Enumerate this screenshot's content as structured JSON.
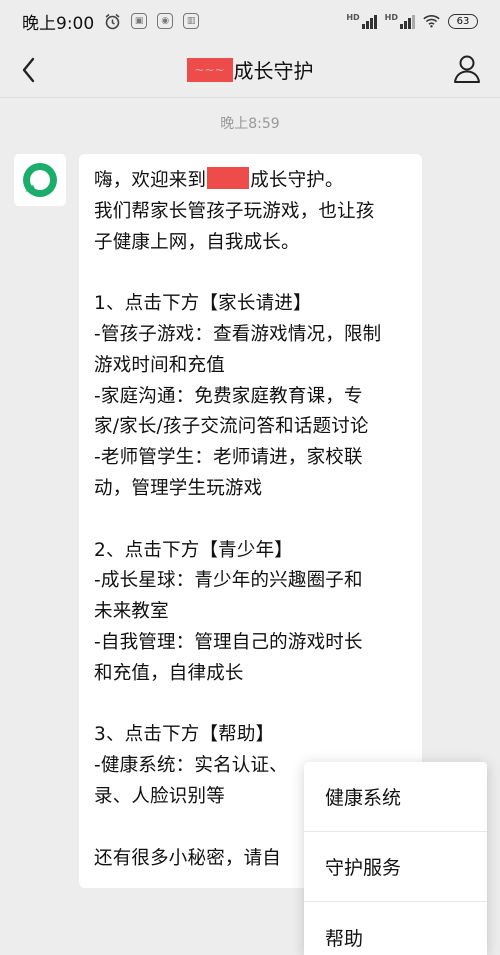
{
  "status_bar": {
    "time": "晚上9:00",
    "network_label_1": "HD",
    "network_label_2": "HD",
    "battery": "63"
  },
  "header": {
    "title_redacted": "~~~",
    "title_suffix": "成长守护",
    "back_icon": "chevron-left-icon",
    "profile_icon": "user-icon"
  },
  "chat": {
    "timestamp": "晚上8:59",
    "message": {
      "line1_before": "嗨，欢迎来到",
      "line1_after": "成长守护。",
      "lines": [
        "我们帮家长管孩子玩游戏，也让孩",
        "子健康上网，自我成长。",
        "",
        "1、点击下方【家长请进】",
        "-管孩子游戏：查看游戏情况，限制",
        "游戏时间和充值",
        "-家庭沟通：免费家庭教育课，专",
        "家/家长/孩子交流问答和话题讨论",
        "-老师管学生：老师请进，家校联",
        "动，管理学生玩游戏",
        "",
        "2、点击下方【青少年】",
        "-成长星球：青少年的兴趣圈子和",
        "未来教室",
        "-自我管理：管理自己的游戏时长",
        "和充值，自律成长",
        "",
        "3、点击下方【帮助】",
        "-健康系统：实名认证、",
        "录、人脸识别等",
        "",
        "还有很多小秘密，请自"
      ]
    }
  },
  "popup_menu": {
    "items": [
      "健康系统",
      "守护服务",
      "帮助"
    ]
  },
  "colors": {
    "background": "#ededed",
    "bubble": "#ffffff",
    "brand_green": "#1aad6b",
    "redaction": "#ee4b4b"
  }
}
